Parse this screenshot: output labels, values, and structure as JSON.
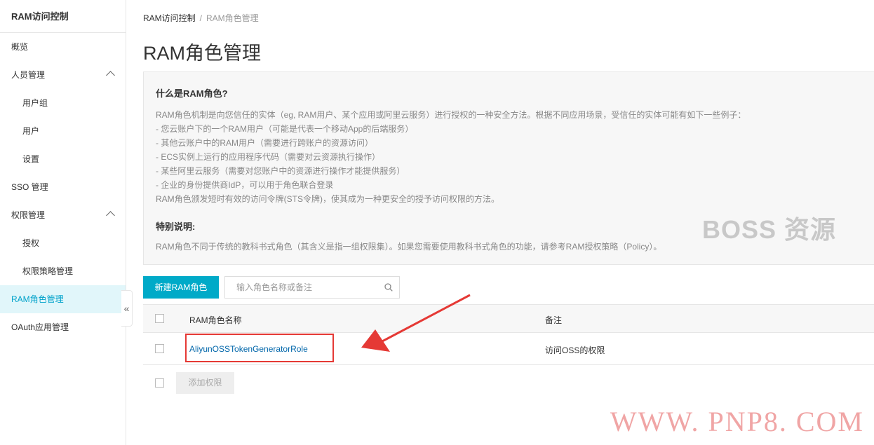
{
  "sidebar": {
    "title": "RAM访问控制",
    "items": [
      {
        "label": "概览"
      },
      {
        "label": "人员管理"
      },
      {
        "label": "用户组"
      },
      {
        "label": "用户"
      },
      {
        "label": "设置"
      },
      {
        "label": "SSO 管理"
      },
      {
        "label": "权限管理"
      },
      {
        "label": "授权"
      },
      {
        "label": "权限策略管理"
      },
      {
        "label": "RAM角色管理"
      },
      {
        "label": "OAuth应用管理"
      }
    ],
    "collapse_glyph": "«"
  },
  "breadcrumb": {
    "root": "RAM访问控制",
    "sep": "/",
    "current": "RAM角色管理"
  },
  "page": {
    "title": "RAM角色管理"
  },
  "info": {
    "heading": "什么是RAM角色?",
    "lines": [
      "RAM角色机制是向您信任的实体（eg, RAM用户、某个应用或阿里云服务）进行授权的一种安全方法。根据不同应用场景，受信任的实体可能有如下一些例子：",
      "- 您云账户下的一个RAM用户（可能是代表一个移动App的后端服务）",
      "- 其他云账户中的RAM用户（需要进行跨账户的资源访问）",
      "- ECS实例上运行的应用程序代码（需要对云资源执行操作）",
      "- 某些阿里云服务（需要对您账户中的资源进行操作才能提供服务）",
      "- 企业的身份提供商IdP，可以用于角色联合登录",
      "RAM角色颁发短时有效的访问令牌(STS令牌)，使其成为一种更安全的授予访问权限的方法。"
    ],
    "heading2": "特别说明:",
    "note": "RAM角色不同于传统的教科书式角色（其含义是指一组权限集）。如果您需要使用教科书式角色的功能，请参考RAM授权策略（Policy）。",
    "watermark": "BOSS 资源"
  },
  "toolbar": {
    "create_label": "新建RAM角色",
    "search_placeholder": "输入角色名称或备注"
  },
  "table": {
    "headers": {
      "name": "RAM角色名称",
      "note": "备注"
    },
    "rows": [
      {
        "name": "AliyunOSSTokenGeneratorRole",
        "note": "访问OSS的权限"
      }
    ],
    "footer_button": "添加权限"
  },
  "site_watermark": "WWW. PNP8. COM",
  "colors": {
    "accent": "#00aac8",
    "link": "#0066aa",
    "highlight": "#e53935",
    "active_bg": "#e1f6fa"
  }
}
